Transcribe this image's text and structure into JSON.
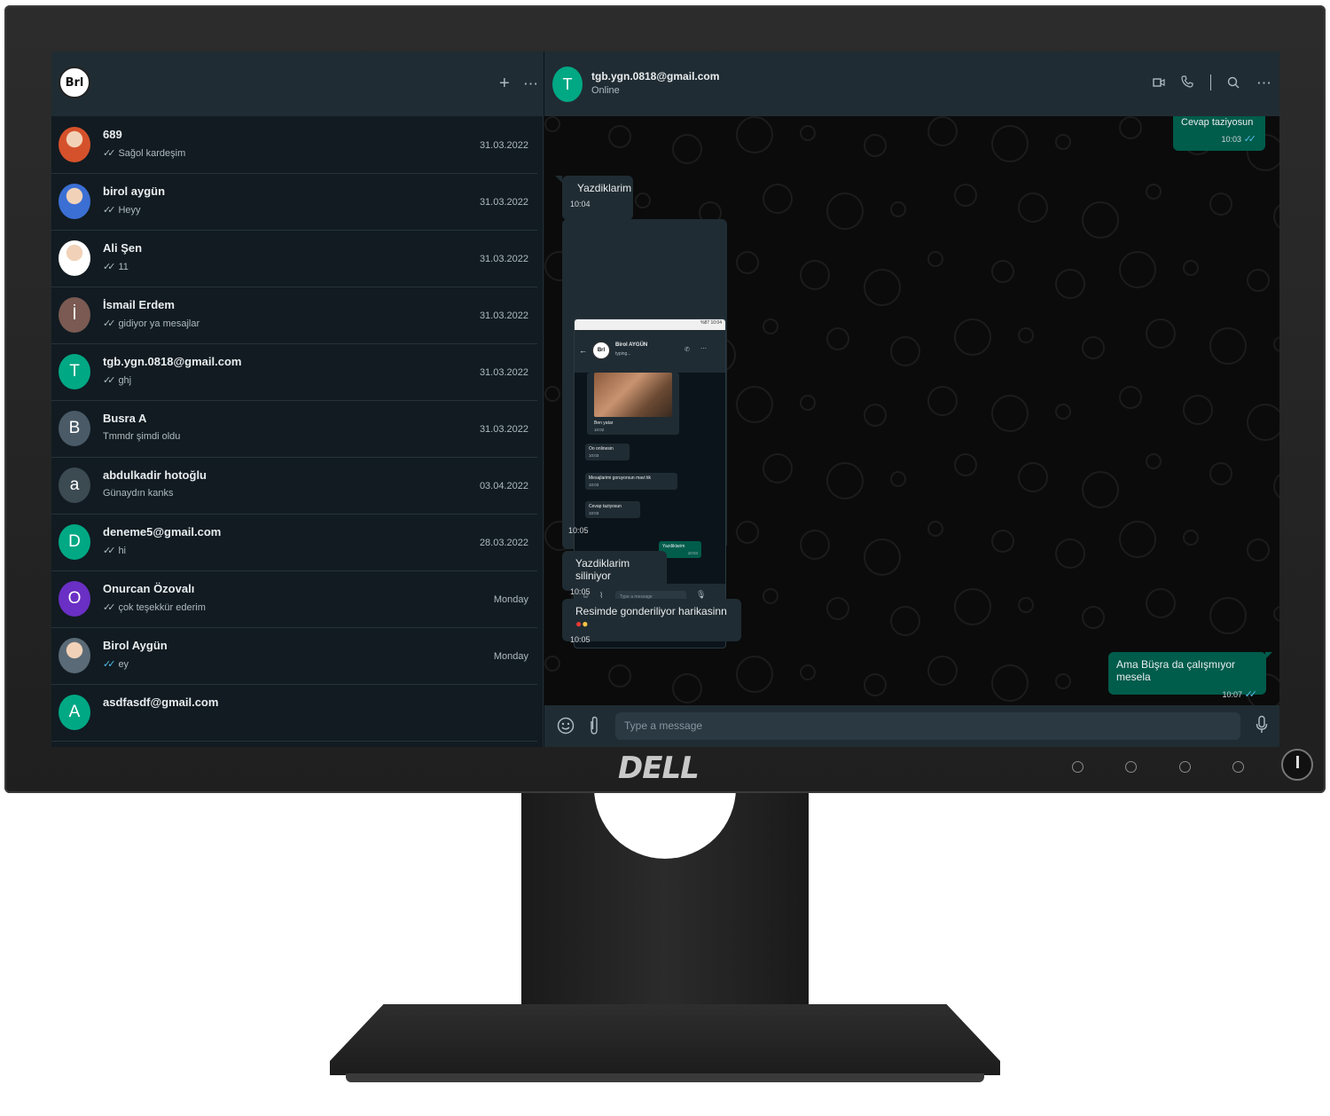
{
  "brand": "DELL",
  "sidebar": {
    "profile_logo": "Brl",
    "header_icons": [
      "plus-icon",
      "more-icon"
    ],
    "chats": [
      {
        "name": "689",
        "preview": "Sağol kardeşim",
        "date": "31.03.2022",
        "ticks": "double",
        "avatar_letter": "",
        "avatar_color": "#d5512b"
      },
      {
        "name": "birol aygün",
        "preview": "Heyy",
        "date": "31.03.2022",
        "ticks": "double",
        "avatar_letter": "",
        "avatar_color": "#3b6fd4"
      },
      {
        "name": "Ali Şen",
        "preview": "11",
        "date": "31.03.2022",
        "ticks": "double",
        "avatar_letter": "",
        "avatar_color": "#ffffff"
      },
      {
        "name": "İsmail Erdem",
        "preview": "gidiyor ya mesajlar",
        "date": "31.03.2022",
        "ticks": "double",
        "avatar_letter": "İ",
        "avatar_color": "#7a5a52"
      },
      {
        "name": "tgb.ygn.0818@gmail.com",
        "preview": "ghj",
        "date": "31.03.2022",
        "ticks": "double",
        "avatar_letter": "T",
        "avatar_color": "#00a884"
      },
      {
        "name": "Busra A",
        "preview": "Tmmdr şimdi oldu",
        "date": "31.03.2022",
        "ticks": "none",
        "avatar_letter": "B",
        "avatar_color": "#4a5a66"
      },
      {
        "name": "abdulkadir hotoğlu",
        "preview": "Günaydın kanks",
        "date": "03.04.2022",
        "ticks": "none",
        "avatar_letter": "a",
        "avatar_color": "#3c4a52"
      },
      {
        "name": "deneme5@gmail.com",
        "preview": "hi",
        "date": "28.03.2022",
        "ticks": "double",
        "avatar_letter": "D",
        "avatar_color": "#00a884"
      },
      {
        "name": "Onurcan Özovalı",
        "preview": "çok teşekkür ederim",
        "date": "Monday",
        "ticks": "double",
        "avatar_letter": "O",
        "avatar_color": "#6a2fc4"
      },
      {
        "name": "Birol Aygün",
        "preview": "ey",
        "date": "Monday",
        "ticks": "blue",
        "avatar_letter": "",
        "avatar_color": "#5a6a76"
      },
      {
        "name": "asdfasdf@gmail.com",
        "preview": "",
        "date": "",
        "ticks": "none",
        "avatar_letter": "A",
        "avatar_color": "#00a884"
      }
    ]
  },
  "chat": {
    "contact_initial": "T",
    "contact_name": "tgb.ygn.0818@gmail.com",
    "contact_status": "Online",
    "header_icons": [
      "video-icon",
      "phone-icon",
      "search-icon",
      "more-icon"
    ],
    "messages": {
      "m1": {
        "text": "Cevap taziyosun",
        "time": "10:03"
      },
      "m2": {
        "text": "Yazdiklarim",
        "time": "10:04"
      },
      "m3": {
        "time": "10:05"
      },
      "m4": {
        "text": "Yazdiklarim siliniyor",
        "time": "10:05"
      },
      "m5": {
        "text": "Resimde gonderiliyor harikasinn",
        "time": "10:05"
      },
      "m6": {
        "text": "Ama Büşra da çalışmıyor mesela",
        "time": "10:07"
      }
    },
    "embedded_screenshot": {
      "status_bar": "%87 10:04",
      "logo": "Brl",
      "name": "Birol AYGÜN",
      "status": "typing...",
      "bubbles": [
        {
          "text": "Ben yatar",
          "time": "10:02"
        },
        {
          "text": "Oo onlinesin",
          "time": "10:03"
        },
        {
          "text": "Mesajlarimi goruyorsun mavi tik",
          "time": "10:03"
        },
        {
          "text": "Cevap taziyosun",
          "time": "10:03"
        },
        {
          "text": "Yazdiklarim",
          "time": "10:04"
        }
      ],
      "input_placeholder": "Type a message"
    },
    "input_placeholder": "Type a message",
    "footer_icons": [
      "emoji-icon",
      "attach-icon",
      "mic-icon"
    ]
  },
  "colors": {
    "accent": "#00a884",
    "outgoing_bubble": "#005c4b",
    "incoming_bubble": "#202c33",
    "read_ticks": "#53bdeb"
  }
}
